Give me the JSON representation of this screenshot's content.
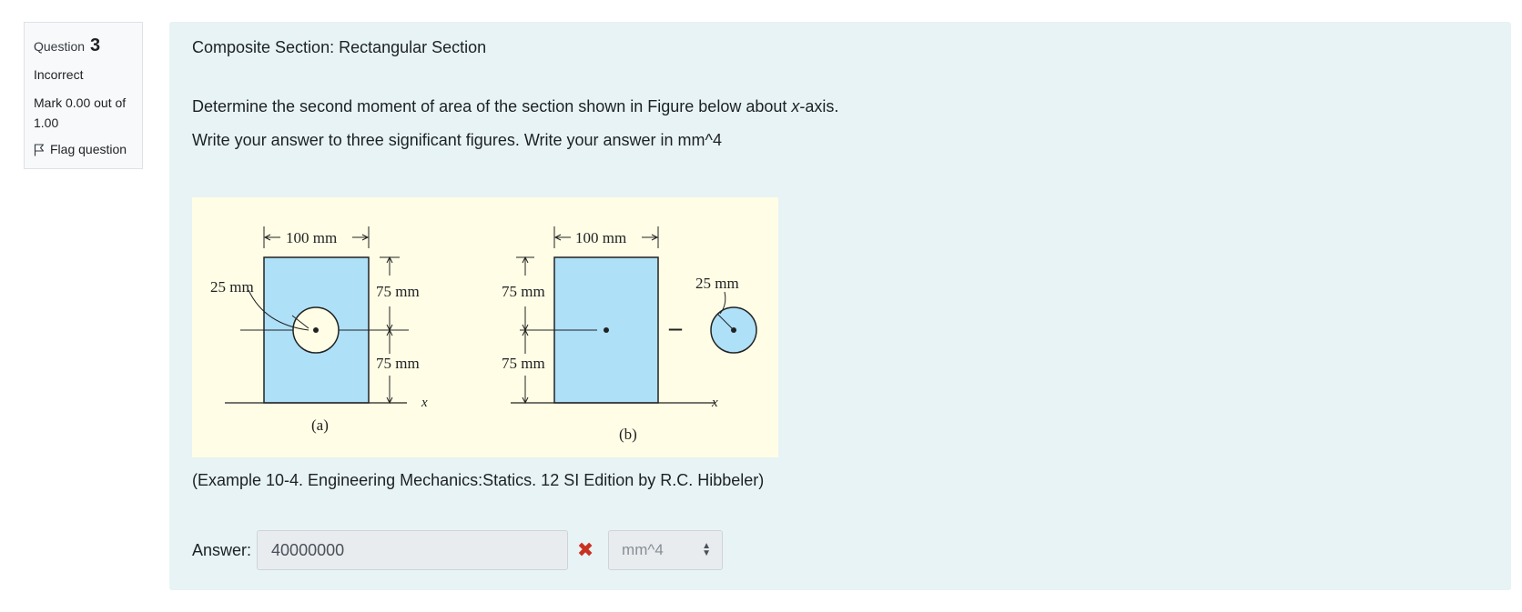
{
  "question_info": {
    "label": "Question",
    "number": "3",
    "state": "Incorrect",
    "grade": "Mark 0.00 out of 1.00",
    "flag_label": "Flag question"
  },
  "question": {
    "title": "Composite Section: Rectangular Section",
    "text1_pre": "Determine the second moment of area of the section shown in Figure below about ",
    "text1_axis": "x",
    "text1_post": "-axis.",
    "text2": "Write your answer to three significant figures. Write your answer in mm^4",
    "caption": "(Example 10-4. Engineering Mechanics:Statics. 12 SI Edition by R.C. Hibbeler)"
  },
  "figure": {
    "a": {
      "width_dim": "100 mm",
      "radius_dim": "25 mm",
      "upper_dim": "75 mm",
      "lower_dim": "75 mm",
      "axis": "x",
      "label": "(a)"
    },
    "b": {
      "width_dim": "100 mm",
      "upper_dim": "75 mm",
      "lower_dim": "75 mm",
      "minus": "–",
      "radius_dim": "25 mm",
      "axis": "x",
      "label": "(b)"
    },
    "colors": {
      "fill": "#aee0f8",
      "background": "#fffde6"
    }
  },
  "answer": {
    "label": "Answer:",
    "value": "40000000",
    "status_icon": "cross-icon",
    "unit_selected": "mm^4"
  },
  "colors": {
    "panel": "#e7f3f5",
    "incorrect": "#ca3120"
  }
}
